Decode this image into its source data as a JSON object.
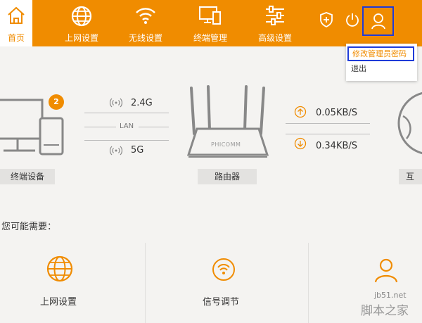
{
  "nav": {
    "home": "首页",
    "internet": "上网设置",
    "wireless": "无线设置",
    "devices": "终端管理",
    "advanced": "高级设置"
  },
  "toolbar": {
    "shield_icon": "shield-plus-icon",
    "power_icon": "power-icon",
    "user_icon": "user-icon"
  },
  "user_menu": {
    "change_password": "修改管理员密码",
    "logout": "退出"
  },
  "status": {
    "device_count": "2",
    "band_24": "2.4G",
    "lan": "LAN",
    "band_5": "5G",
    "upload": "0.05KB/S",
    "download": "0.34KB/S",
    "terminal_label": "终端设备",
    "router_label": "路由器",
    "router_brand": "PHICOMM",
    "internet_label": "互"
  },
  "suggestions": {
    "heading": "您可能需要：",
    "items": [
      {
        "label": "上网设置",
        "icon": "globe-icon"
      },
      {
        "label": "信号调节",
        "icon": "signal-icon"
      },
      {
        "label": "",
        "icon": "user-icon"
      }
    ]
  },
  "watermark": {
    "site": "jb51.net",
    "name": "脚本之家"
  },
  "colors": {
    "accent": "#f08c00",
    "highlight_box": "#1f3bd8"
  }
}
